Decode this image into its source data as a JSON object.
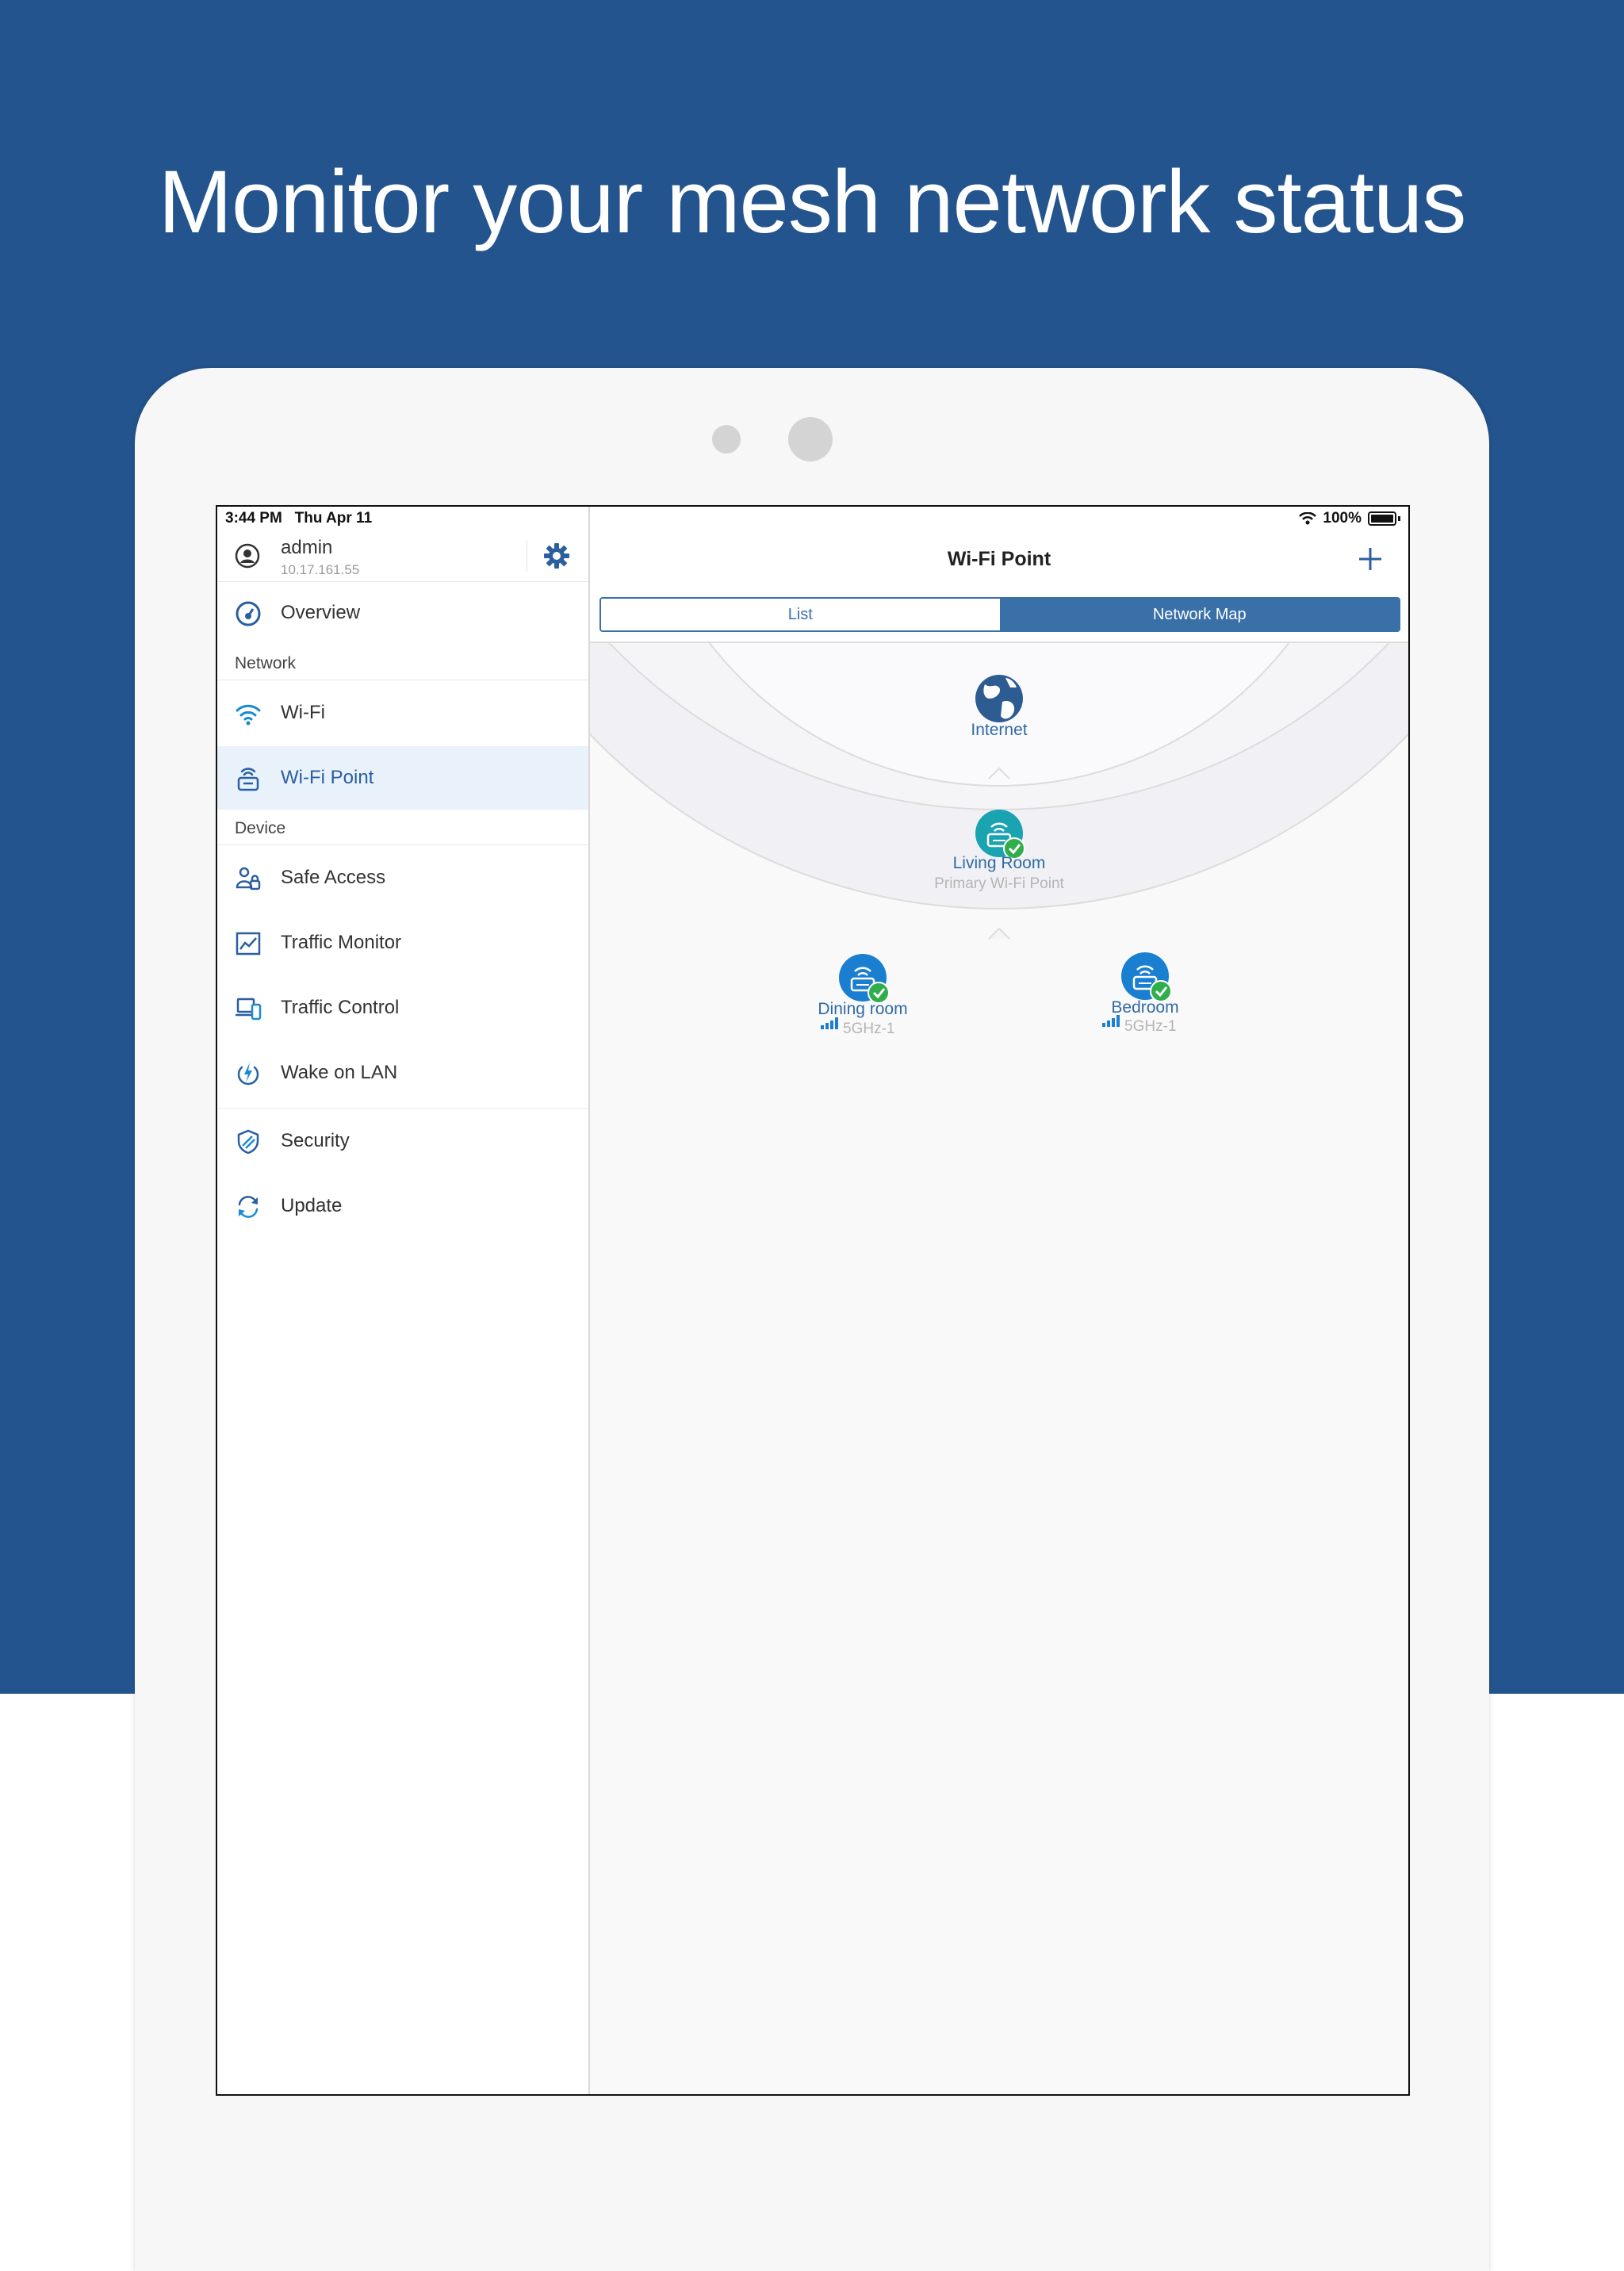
{
  "hero": {
    "title": "Monitor your mesh network status"
  },
  "status_bar": {
    "time": "3:44 PM",
    "date": "Thu Apr 11",
    "battery": "100%"
  },
  "account": {
    "name": "admin",
    "ip": "10.17.161.55",
    "icon": "user-circle-icon",
    "settings_icon": "gear-icon"
  },
  "sidebar": {
    "overview": {
      "label": "Overview",
      "icon": "speedometer-icon"
    },
    "network_section": "Network",
    "network_items": [
      {
        "label": "Wi-Fi",
        "icon": "wifi-icon"
      },
      {
        "label": "Wi-Fi Point",
        "icon": "wifi-point-icon",
        "active": true
      }
    ],
    "device_section": "Device",
    "device_items": [
      {
        "label": "Safe Access",
        "icon": "users-icon"
      },
      {
        "label": "Traffic Monitor",
        "icon": "line-chart-icon"
      },
      {
        "label": "Traffic Control",
        "icon": "devices-icon"
      },
      {
        "label": "Wake on LAN",
        "icon": "power-icon"
      }
    ],
    "other_items": [
      {
        "label": "Security",
        "icon": "shield-icon"
      },
      {
        "label": "Update",
        "icon": "refresh-icon"
      }
    ]
  },
  "main": {
    "title": "Wi-Fi Point",
    "add_icon": "plus-icon",
    "tabs": [
      {
        "label": "List"
      },
      {
        "label": "Network Map",
        "selected": true
      }
    ],
    "map": {
      "internet": {
        "label": "Internet"
      },
      "primary": {
        "label": "Living Room",
        "sub": "Primary Wi-Fi Point",
        "status": "online"
      },
      "nodes": [
        {
          "label": "Dining room",
          "band": "5GHz-1",
          "status": "online"
        },
        {
          "label": "Bedroom",
          "band": "5GHz-1",
          "status": "online"
        }
      ]
    }
  },
  "colors": {
    "brand_blue": "#24548e",
    "accent": "#3a70a8",
    "node_blue": "#1a7fd0",
    "primary_teal": "#1aa3b0",
    "ok_green": "#2fae4b"
  }
}
